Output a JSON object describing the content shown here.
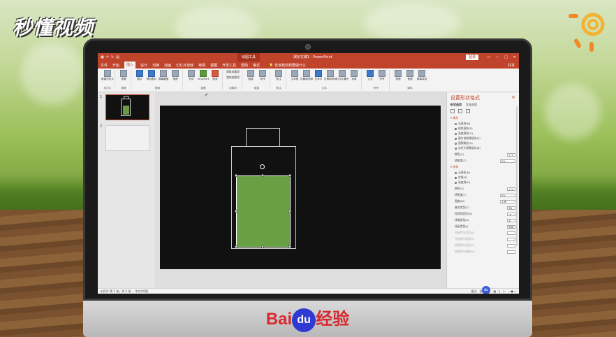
{
  "watermark": {
    "brand": "秒懂视频"
  },
  "footer": {
    "baidu_bai": "Bai",
    "baidu_du": "du",
    "baidu_jingyan": "经验"
  },
  "ppt": {
    "title": {
      "context_tab": "绘图工具",
      "document": "演示文稿1 - PowerPoint",
      "login": "登录"
    },
    "tabs": [
      "文件",
      "开始",
      "插入",
      "设计",
      "切换",
      "动画",
      "幻灯片放映",
      "审阅",
      "视图",
      "开发工具",
      "帮助",
      "格式"
    ],
    "active_tab": "插入",
    "tell_me": "告诉我你想要做什么",
    "share": "共享",
    "ribbon_groups": [
      {
        "name": "幻灯片",
        "buttons": [
          "新建幻灯片"
        ]
      },
      {
        "name": "表格",
        "buttons": [
          "表格"
        ]
      },
      {
        "name": "图像",
        "buttons": [
          "图片",
          "联机图片",
          "屏幕截图",
          "相册"
        ]
      },
      {
        "name": "插图",
        "buttons": [
          "形状",
          "SmartArt",
          "图表"
        ]
      },
      {
        "name": "加载项",
        "buttons": [
          "获取加载项",
          "我的加载项"
        ]
      },
      {
        "name": "链接",
        "buttons": [
          "链接",
          "动作"
        ]
      },
      {
        "name": "批注",
        "buttons": [
          "批注"
        ]
      },
      {
        "name": "文本",
        "buttons": [
          "文本框",
          "页眉和页脚",
          "艺术字",
          "日期和时间",
          "幻灯片编号",
          "对象"
        ]
      },
      {
        "name": "符号",
        "buttons": [
          "公式",
          "符号"
        ]
      },
      {
        "name": "媒体",
        "buttons": [
          "视频",
          "音频",
          "屏幕录制"
        ]
      }
    ],
    "slide_numbers": [
      "1",
      "2"
    ],
    "format_pane": {
      "title": "设置形状格式",
      "tabs": [
        "形状选项",
        "文本选项"
      ],
      "fill_section": "填充",
      "fill_options": [
        "无填充(N)",
        "纯色填充(S)",
        "渐变填充(G)",
        "图片或纹理填充(P)",
        "图案填充(A)",
        "幻灯片背景填充(B)"
      ],
      "fill_color_label": "颜色(C)",
      "fill_transparency_label": "透明度(T)",
      "fill_transparency_value": "0%",
      "line_section": "线条",
      "line_options": [
        "无线条(N)",
        "实线(S)",
        "渐变线(G)"
      ],
      "line_rows": [
        {
          "label": "颜色(C)",
          "value": ""
        },
        {
          "label": "透明度(T)",
          "value": "0%"
        },
        {
          "label": "宽度(W)",
          "value": "1 磅"
        },
        {
          "label": "复合类型(C)",
          "value": ""
        },
        {
          "label": "短划线类型(D)",
          "value": ""
        },
        {
          "label": "线端类型(A)",
          "value": "平"
        },
        {
          "label": "连接类型(J)",
          "value": "斜接"
        },
        {
          "label": "开始箭头类型(B)",
          "value": ""
        },
        {
          "label": "开始箭头粗细(S)",
          "value": ""
        },
        {
          "label": "结尾箭头类型(E)",
          "value": ""
        },
        {
          "label": "结尾箭头粗细(N)",
          "value": ""
        }
      ]
    },
    "status": {
      "slide_info": "幻灯片 第 1 张，共 2 张",
      "language": "中文(中国)",
      "notes": "备注",
      "comments": "批注"
    }
  }
}
